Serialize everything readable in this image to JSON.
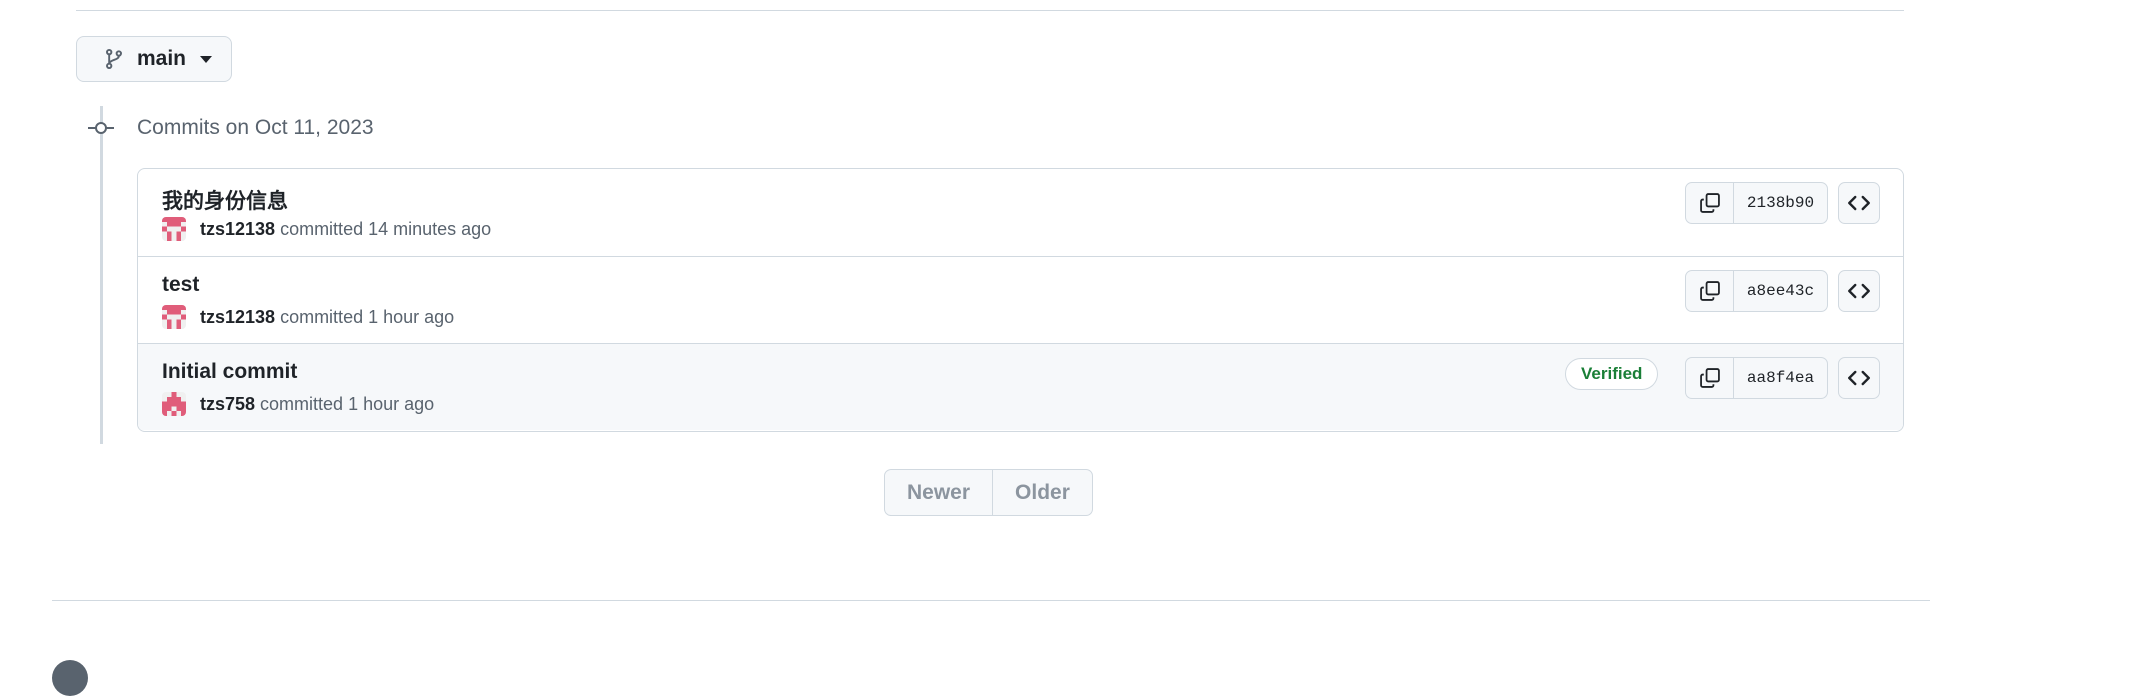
{
  "branch": {
    "label": "main"
  },
  "timeline": {
    "title": "Commits on Oct 11, 2023"
  },
  "commits": [
    {
      "message": "我的身份信息",
      "author": "tzs12138",
      "action": "committed",
      "time": "14 minutes ago",
      "sha": "2138b90",
      "verified": ""
    },
    {
      "message": "test",
      "author": "tzs12138",
      "action": "committed",
      "time": "1 hour ago",
      "sha": "a8ee43c",
      "verified": ""
    },
    {
      "message": "Initial commit",
      "author": "tzs758",
      "action": "committed",
      "time": "1 hour ago",
      "sha": "aa8f4ea",
      "verified": "Verified"
    }
  ],
  "pagination": {
    "newer": "Newer",
    "older": "Older"
  },
  "icons": {
    "branch": "git-branch-icon",
    "timeline": "git-commit-icon",
    "copy": "copy-icon",
    "browse": "code-icon",
    "footer": "github-logo-icon"
  },
  "colors": {
    "verified": "#1a7f37",
    "border": "#d1d9e0",
    "muted": "#59636e",
    "avatar": "#e05d7a"
  }
}
